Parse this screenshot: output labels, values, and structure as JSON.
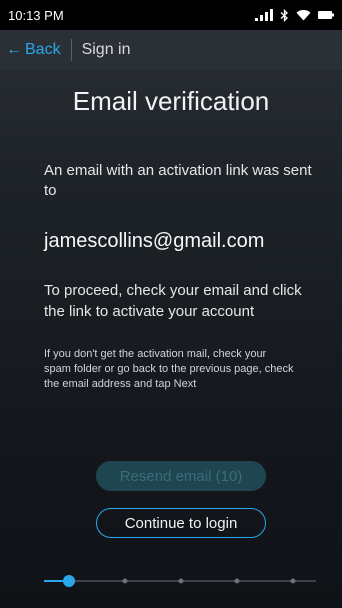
{
  "status_bar": {
    "time": "10:13 PM",
    "icons": [
      "signal-icon",
      "bluetooth-icon",
      "wifi-icon",
      "battery-icon"
    ]
  },
  "nav": {
    "back_label": "Back",
    "back_arrow": "←",
    "title": "Sign in"
  },
  "content": {
    "headline": "Email verification",
    "sent_text": "An email with an activation link was sent to",
    "email": "jamescollins@gmail.com",
    "proceed_text": "To proceed, check your email and click the link to activate your account",
    "help_text": "If you don't get the activation mail, check your spam folder or go back to the previous page, check the email address and tap Next"
  },
  "buttons": {
    "resend_label": "Resend email (10)",
    "continue_label": "Continue to login"
  },
  "progress": {
    "total_steps": 5,
    "current_step": 1
  },
  "colors": {
    "accent": "#29a7ea",
    "resend_bg": "#1f4550",
    "resend_text": "#3a6c7a",
    "status_bar_bg": "#000000",
    "nav_bg": "#2b3036"
  }
}
